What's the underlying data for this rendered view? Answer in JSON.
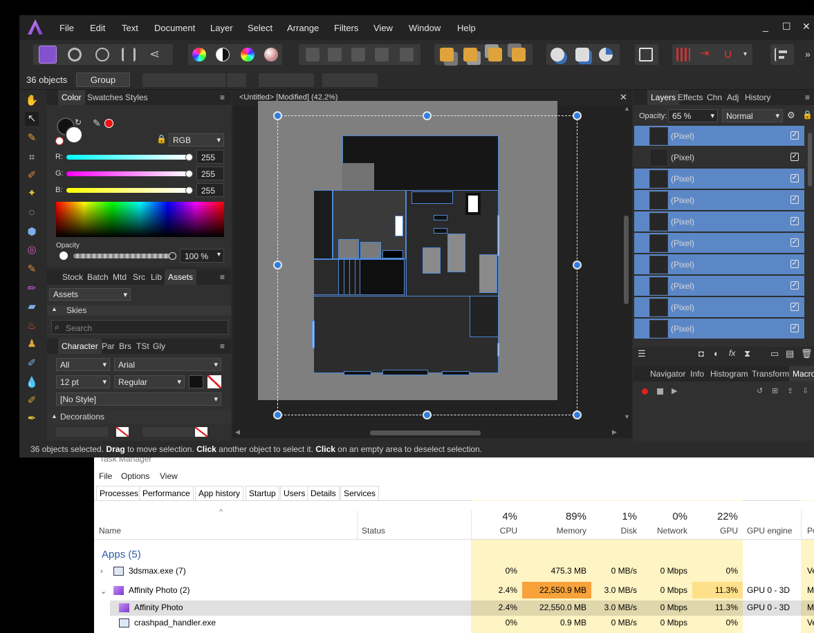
{
  "affinity": {
    "menu": [
      "File",
      "Edit",
      "Text",
      "Document",
      "Layer",
      "Select",
      "Arrange",
      "Filters",
      "View",
      "Window",
      "Help"
    ],
    "window_controls": [
      "_",
      "☐",
      "✕"
    ],
    "context": {
      "count": "36 objects",
      "group_button": "Group"
    },
    "color_panel": {
      "tabs": [
        "Color",
        "Swatches",
        "Styles"
      ],
      "model": "RGB",
      "r_label": "R:",
      "g_label": "G:",
      "b_label": "B:",
      "r": "255",
      "g": "255",
      "b": "255",
      "opacity_label": "Opacity",
      "opacity_value": "100 %"
    },
    "assets_panel": {
      "tabs": [
        "Stock",
        "Batch",
        "Mtd",
        "Src",
        "Lib",
        "Assets"
      ],
      "category": "Assets",
      "section": "Skies",
      "search_placeholder": "Search"
    },
    "character_panel": {
      "tabs": [
        "Character",
        "Par",
        "Brs",
        "TSt",
        "Gly"
      ],
      "filter": "All",
      "font": "Arial",
      "size": "12 pt",
      "weight": "Regular",
      "style": "[No Style]",
      "decorations_label": "Decorations"
    },
    "document_tab": "<Untitled> [Modified] (42.2%)",
    "layers_panel": {
      "tabs": [
        "Layers",
        "Effects",
        "Chn",
        "Adj",
        "History"
      ],
      "opacity_label": "Opacity:",
      "opacity_value": "65 %",
      "blend_mode": "Normal",
      "rows": [
        {
          "name": "(Pixel)",
          "selected": true
        },
        {
          "name": "(Pixel)",
          "selected": false
        },
        {
          "name": "(Pixel)",
          "selected": true
        },
        {
          "name": "(Pixel)",
          "selected": true
        },
        {
          "name": "(Pixel)",
          "selected": true
        },
        {
          "name": "(Pixel)",
          "selected": true
        },
        {
          "name": "(Pixel)",
          "selected": true
        },
        {
          "name": "(Pixel)",
          "selected": true
        },
        {
          "name": "(Pixel)",
          "selected": true
        },
        {
          "name": "(Pixel)",
          "selected": true
        }
      ]
    },
    "nav_panel": {
      "tabs": [
        "Navigator",
        "Info",
        "Histogram",
        "Transform",
        "Macro"
      ]
    },
    "status": {
      "p1": "36 objects selected. ",
      "b1": "Drag",
      "p2": " to move selection. ",
      "b2": "Click",
      "p3": " another object to select it. ",
      "b3": "Click",
      "p4": " on an empty area to deselect selection."
    }
  },
  "taskmgr": {
    "title": "Task Manager",
    "menu": [
      "File",
      "Options",
      "View"
    ],
    "tabs": [
      "Processes",
      "Performance",
      "App history",
      "Startup",
      "Users",
      "Details",
      "Services"
    ],
    "columns": {
      "name": "Name",
      "status": "Status",
      "cpu_pct": "4%",
      "cpu": "CPU",
      "mem_pct": "89%",
      "mem": "Memory",
      "disk_pct": "1%",
      "disk": "Disk",
      "net_pct": "0%",
      "net": "Network",
      "gpu_pct": "22%",
      "gpu": "GPU",
      "gpu_engine": "GPU engine",
      "power": "Po"
    },
    "group": "Apps (5)",
    "rows": [
      {
        "name": "3dsmax.exe (7)",
        "cpu": "0%",
        "mem": "475.3 MB",
        "disk": "0 MB/s",
        "net": "0 Mbps",
        "gpu": "0%",
        "engine": "",
        "power": "Ve"
      },
      {
        "name": "Affinity Photo (2)",
        "cpu": "2.4%",
        "mem": "22,550.9 MB",
        "disk": "3.0 MB/s",
        "net": "0 Mbps",
        "gpu": "11.3%",
        "engine": "GPU 0 - 3D",
        "power": "M"
      },
      {
        "name": "Affinity Photo",
        "cpu": "2.4%",
        "mem": "22,550.0 MB",
        "disk": "3.0 MB/s",
        "net": "0 Mbps",
        "gpu": "11.3%",
        "engine": "GPU 0 - 3D",
        "power": "M"
      },
      {
        "name": "crashpad_handler.exe",
        "cpu": "0%",
        "mem": "0.9 MB",
        "disk": "0 MB/s",
        "net": "0 Mbps",
        "gpu": "0%",
        "engine": "",
        "power": "Ve"
      }
    ]
  },
  "colors": {
    "accent": "#5b87c7",
    "brand": "#9a5ae0",
    "mem_hot": "#f7a23a",
    "cell_bg": "#fff4c4"
  }
}
